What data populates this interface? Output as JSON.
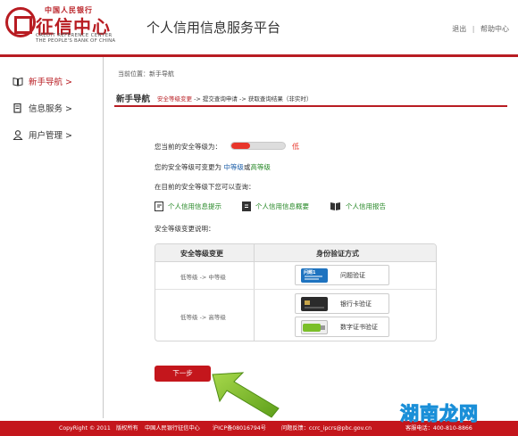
{
  "header": {
    "logo_top": "中国人民银行",
    "logo_main": "征信中心",
    "logo_en_line1": "CREDIT REFERENCE CENTER",
    "logo_en_line2": "THE PEOPLE'S BANK OF CHINA",
    "platform_title": "个人信用信息服务平台",
    "logout": "退出",
    "help": "帮助中心",
    "separator": "|"
  },
  "sidebar": {
    "items": [
      {
        "label": "新手导航 >",
        "icon": "book-icon"
      },
      {
        "label": "信息服务 >",
        "icon": "document-icon"
      },
      {
        "label": "用户管理 >",
        "icon": "user-icon"
      }
    ]
  },
  "main": {
    "breadcrumb": "当前位置：新手导航",
    "nav_title": "新手导航",
    "steps": {
      "current": "安全等级变更",
      "rest": " -> 提交查询申请 -> 获取查询结果（非实时）"
    },
    "security_label": "您当前的安全等级为：",
    "security_level_fraction": 0.35,
    "security_level_text": "低",
    "change_prefix": "您的安全等级可变更为 ",
    "change_mid": "中等级",
    "change_or": "或",
    "change_high": "高等级",
    "query_intro": "在目前的安全等级下您可以查询：",
    "query_links": [
      {
        "label": "个人信用信息提示",
        "icon": "info-doc-icon"
      },
      {
        "label": "个人信用信息概要",
        "icon": "summary-doc-icon"
      },
      {
        "label": "个人信用报告",
        "icon": "report-book-icon"
      }
    ],
    "explain_title": "安全等级变更说明：",
    "table": {
      "headers": [
        "安全等级变更",
        "身份验证方式"
      ],
      "rows": [
        {
          "change": "低等级 -> 中等级",
          "methods": [
            {
              "label": "问题验证",
              "icon": "question-card-icon",
              "icon_text": "问题1"
            }
          ]
        },
        {
          "change": "低等级 -> 高等级",
          "methods": [
            {
              "label": "银行卡验证",
              "icon": "bank-card-icon"
            },
            {
              "label": "数字证书验证",
              "icon": "usb-key-icon"
            }
          ]
        }
      ]
    },
    "next_button": "下一步"
  },
  "footer": {
    "copyright": "CopyRight © 2011",
    "rights": "版权所有",
    "org": "中国人民银行征信中心",
    "icp": "沪ICP备08016794号",
    "feedback": "问题反馈：ccrc_ipcrs@pbc.gov.cn",
    "hotline": "客服电话：400-810-8866"
  },
  "watermark": "湖南龙网",
  "colors": {
    "brand_red": "#b81c22",
    "level_red": "#e8362b",
    "link_green": "#2a8a2a",
    "link_blue": "#1d5fa8",
    "arrow_green": "#7bbf2a"
  }
}
